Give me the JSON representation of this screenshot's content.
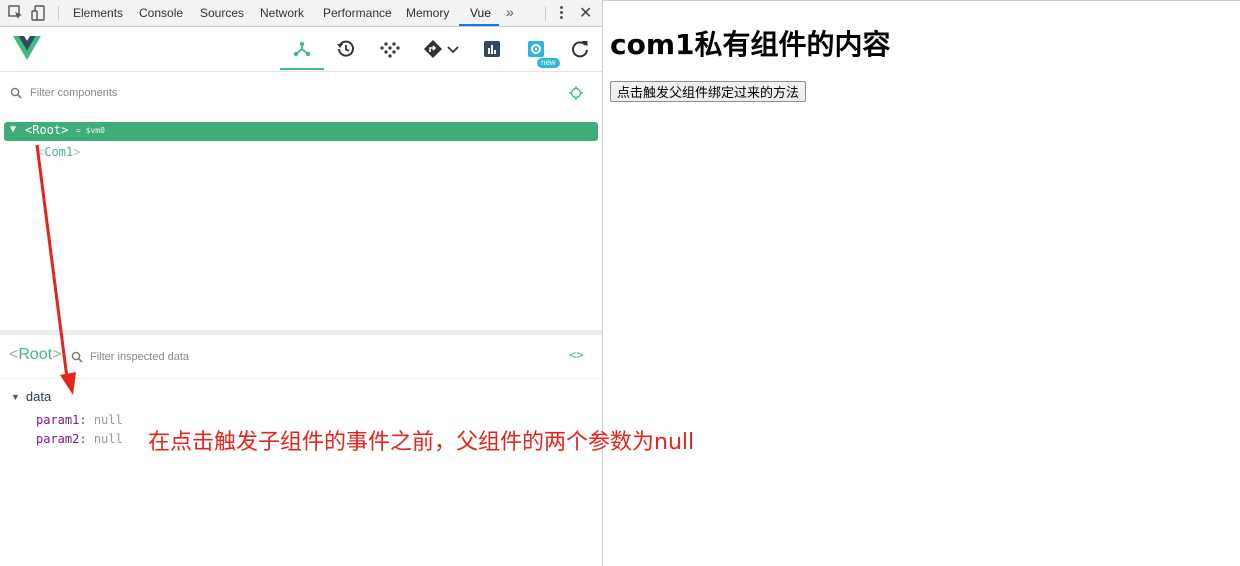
{
  "devtools": {
    "tabs": [
      "Elements",
      "Console",
      "Sources",
      "Network",
      "Performance",
      "Memory",
      "Vue"
    ],
    "active_tab": "Vue",
    "more_label": "»",
    "close_label": "✕"
  },
  "vue_toolbar": {
    "buttons": [
      "components-icon",
      "history-icon",
      "vuex-icon",
      "router-icon",
      "performance-icon",
      "settings-icon",
      "refresh-icon"
    ],
    "active": "components-icon",
    "new_badge": "new",
    "accent_color": "#42b983"
  },
  "components": {
    "filter_placeholder": "Filter components",
    "root": {
      "name": "<Root>",
      "vm_label": "= $vm0"
    },
    "child": {
      "open": "<",
      "name": "Com1",
      "close": ">"
    }
  },
  "inspector": {
    "title_open": "<",
    "title_name": "Root",
    "title_close": ">",
    "filter_placeholder": "Filter inspected data",
    "code_toggle": "<>",
    "section": "data",
    "props": [
      {
        "key": "param1",
        "value": "null"
      },
      {
        "key": "param2",
        "value": "null"
      }
    ]
  },
  "annotation": {
    "text": "在点击触发子组件的事件之前，父组件的两个参数为null",
    "color": "#e8231a"
  },
  "page": {
    "heading": "com1私有组件的内容",
    "button_label": "点击触发父组件绑定过来的方法"
  }
}
